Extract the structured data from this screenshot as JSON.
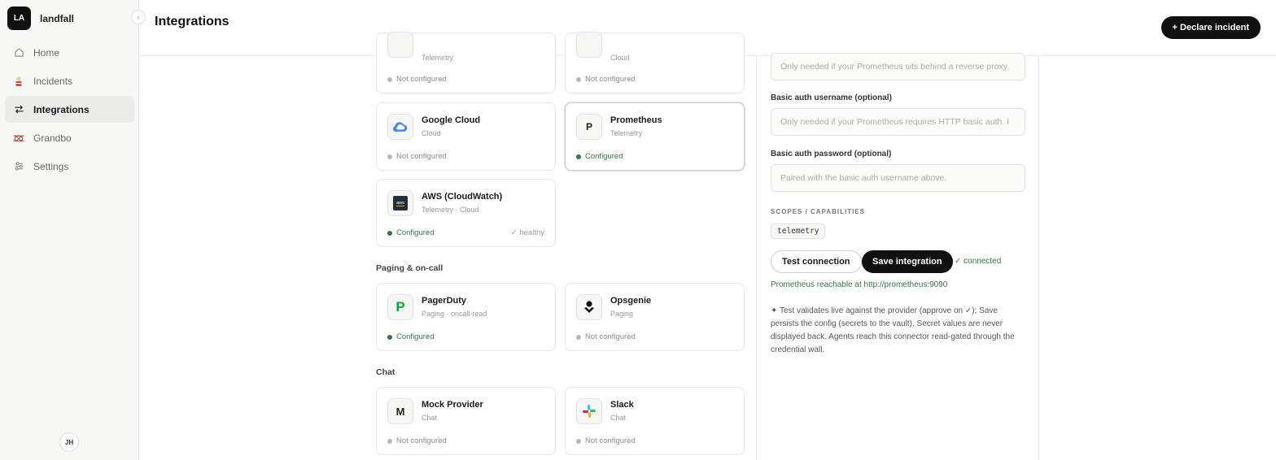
{
  "workspace": {
    "initials": "LA",
    "name": "landfall",
    "collapse_glyph": "‹"
  },
  "nav": {
    "items": [
      {
        "label": "Home",
        "icon": "home-icon"
      },
      {
        "label": "Incidents",
        "icon": "incidents-icon"
      },
      {
        "label": "Integrations",
        "icon": "integrations-icon",
        "active": true
      },
      {
        "label": "Grandbo",
        "icon": "grandbo-icon"
      },
      {
        "label": "Settings",
        "icon": "settings-icon"
      }
    ]
  },
  "user": {
    "initials": "JH"
  },
  "header": {
    "title": "Integrations",
    "declare_label": "+ Declare incident"
  },
  "cards": {
    "top_left": {
      "sub": "Telemetry",
      "status": "Not configured"
    },
    "top_right": {
      "sub": "Cloud",
      "status": "Not configured"
    },
    "google": {
      "name": "Google Cloud",
      "sub": "Cloud",
      "status": "Not configured"
    },
    "prometheus": {
      "icon_letter": "P",
      "name": "Prometheus",
      "sub": "Telemetry",
      "status": "Configured"
    },
    "aws": {
      "icon_text": "aws",
      "name": "AWS (CloudWatch)",
      "sub": "Telemetry · Cloud",
      "status": "Configured",
      "health": "✓ healthy"
    },
    "pagerduty": {
      "icon_letter": "P",
      "name": "PagerDuty",
      "sub": "Paging · oncall-read",
      "status": "Configured"
    },
    "opsgenie": {
      "name": "Opsgenie",
      "sub": "Paging",
      "status": "Not configured"
    },
    "mock": {
      "icon_letter": "M",
      "name": "Mock Provider",
      "sub": "Chat",
      "status": "Not configured"
    },
    "slack": {
      "name": "Slack",
      "sub": "Chat",
      "status": "Not configured"
    }
  },
  "sections": {
    "paging": "Paging & on-call",
    "chat": "Chat"
  },
  "panel": {
    "proxy_placeholder": "Only needed if your Prometheus sits behind a reverse proxy",
    "username_label": "Basic auth username (optional)",
    "username_placeholder": "Only needed if your Prometheus requires HTTP basic auth. I",
    "password_label": "Basic auth password (optional)",
    "password_placeholder": "Paired with the basic auth username above.",
    "scopes_label": "SCOPES / CAPABILITIES",
    "scope_chip": "telemetry",
    "test_label": "Test connection",
    "save_label": "Save integration",
    "connected_text": "✓ connected",
    "reach_text": "Prometheus reachable at http://prometheus:9090",
    "note_text": "✦ Test validates live against the provider (approve on ✓); Save persists the config (secrets to the vault). Secret values are never displayed back. Agents reach this connector read-gated through the credential wall."
  },
  "colors": {
    "accent": "#111111",
    "success": "#2f7a3b",
    "muted": "#9a9a98",
    "sidebar_bg": "#f7f7f6"
  }
}
